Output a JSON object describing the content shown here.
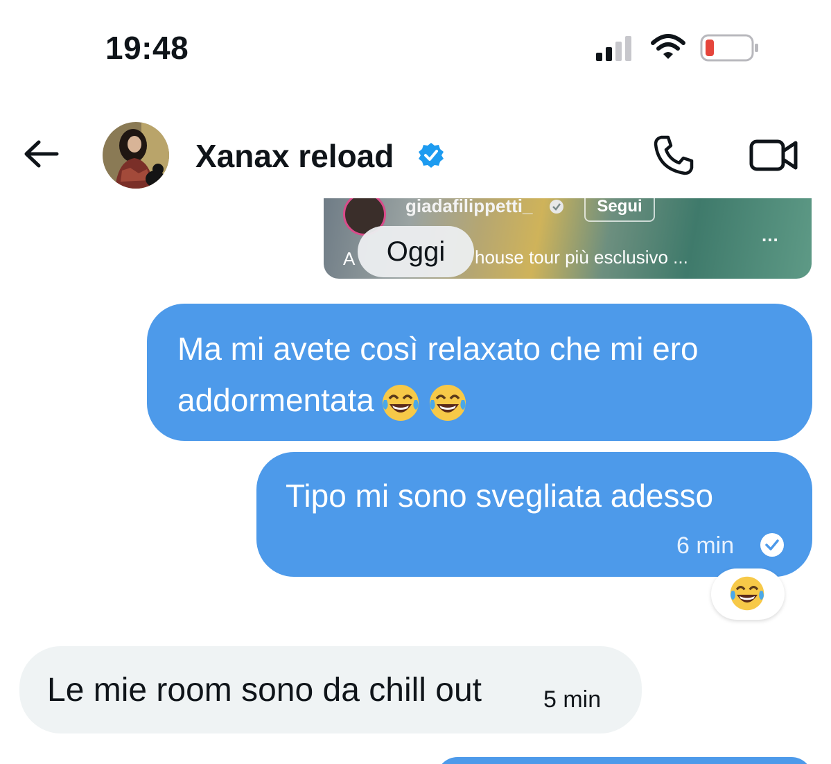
{
  "status_bar": {
    "time": "19:48",
    "signal_icon": "cellular-signal-icon",
    "wifi_icon": "wifi-icon",
    "battery_icon": "battery-low-icon",
    "battery_color": "#e5453b"
  },
  "header": {
    "back_icon": "arrow-left-icon",
    "contact_name": "Xanax reload",
    "verified_icon": "verified-badge-icon",
    "call_icon": "phone-icon",
    "video_icon": "video-camera-icon"
  },
  "shared_post": {
    "username": "giadafilippetti_",
    "follow_label": "Segui",
    "more_label": "...",
    "caption_prefix": "A",
    "caption": "house tour più esclusivo ..."
  },
  "date_separator": "Oggi",
  "messages": [
    {
      "direction": "outgoing",
      "line1": "Ma mi avete così relaxato che mi ero",
      "line2": "addormentata",
      "emoji": [
        "😂",
        "😂"
      ]
    },
    {
      "direction": "outgoing",
      "text": "Tipo mi sono svegliata adesso",
      "time": "6 min",
      "status_icon": "read-check-icon",
      "reaction": "😂"
    },
    {
      "direction": "incoming",
      "text": "Le mie room sono da chill out",
      "time": "5 min"
    }
  ],
  "colors": {
    "outgoing_bubble": "#4d9aea",
    "incoming_bubble": "#eff3f4",
    "verified_blue": "#1d9bf0"
  }
}
